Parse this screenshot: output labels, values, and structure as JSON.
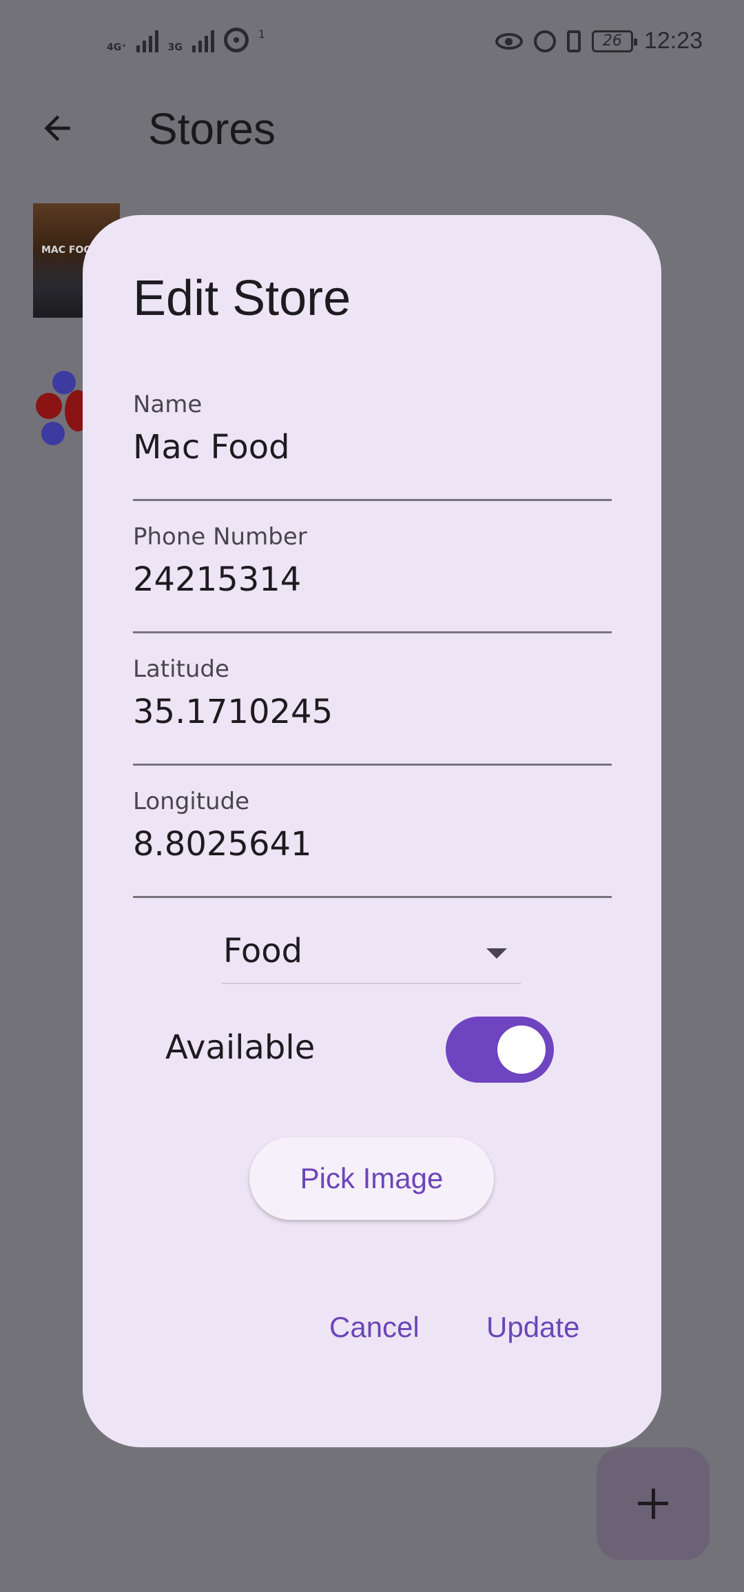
{
  "status_bar": {
    "net1": "4G⁺",
    "net2": "3G",
    "hotspot_sup": "1",
    "battery": "26",
    "time": "12:23",
    "icons": [
      "signal-icon",
      "signal-icon",
      "hotspot-icon",
      "eye-icon",
      "alarm-icon",
      "vibrate-icon",
      "battery-icon"
    ]
  },
  "app_bar": {
    "title": "Stores",
    "back_icon": "arrow-back-icon"
  },
  "background_list": {
    "thumb1_caption": "MAC FOOD"
  },
  "dialog": {
    "title": "Edit Store",
    "fields": [
      {
        "label": "Name",
        "value": "Mac Food"
      },
      {
        "label": "Phone Number",
        "value": "24215314"
      },
      {
        "label": "Latitude",
        "value": "35.1710245"
      },
      {
        "label": "Longitude",
        "value": "8.8025641"
      }
    ],
    "category": {
      "selected": "Food"
    },
    "available": {
      "label": "Available",
      "checked": true
    },
    "pick_image_label": "Pick Image",
    "cancel_label": "Cancel",
    "update_label": "Update"
  },
  "fab": {
    "icon": "add-icon"
  },
  "colors": {
    "accent": "#6f44c0",
    "dialog_bg": "#ede5f5",
    "scrim": "#737278"
  }
}
